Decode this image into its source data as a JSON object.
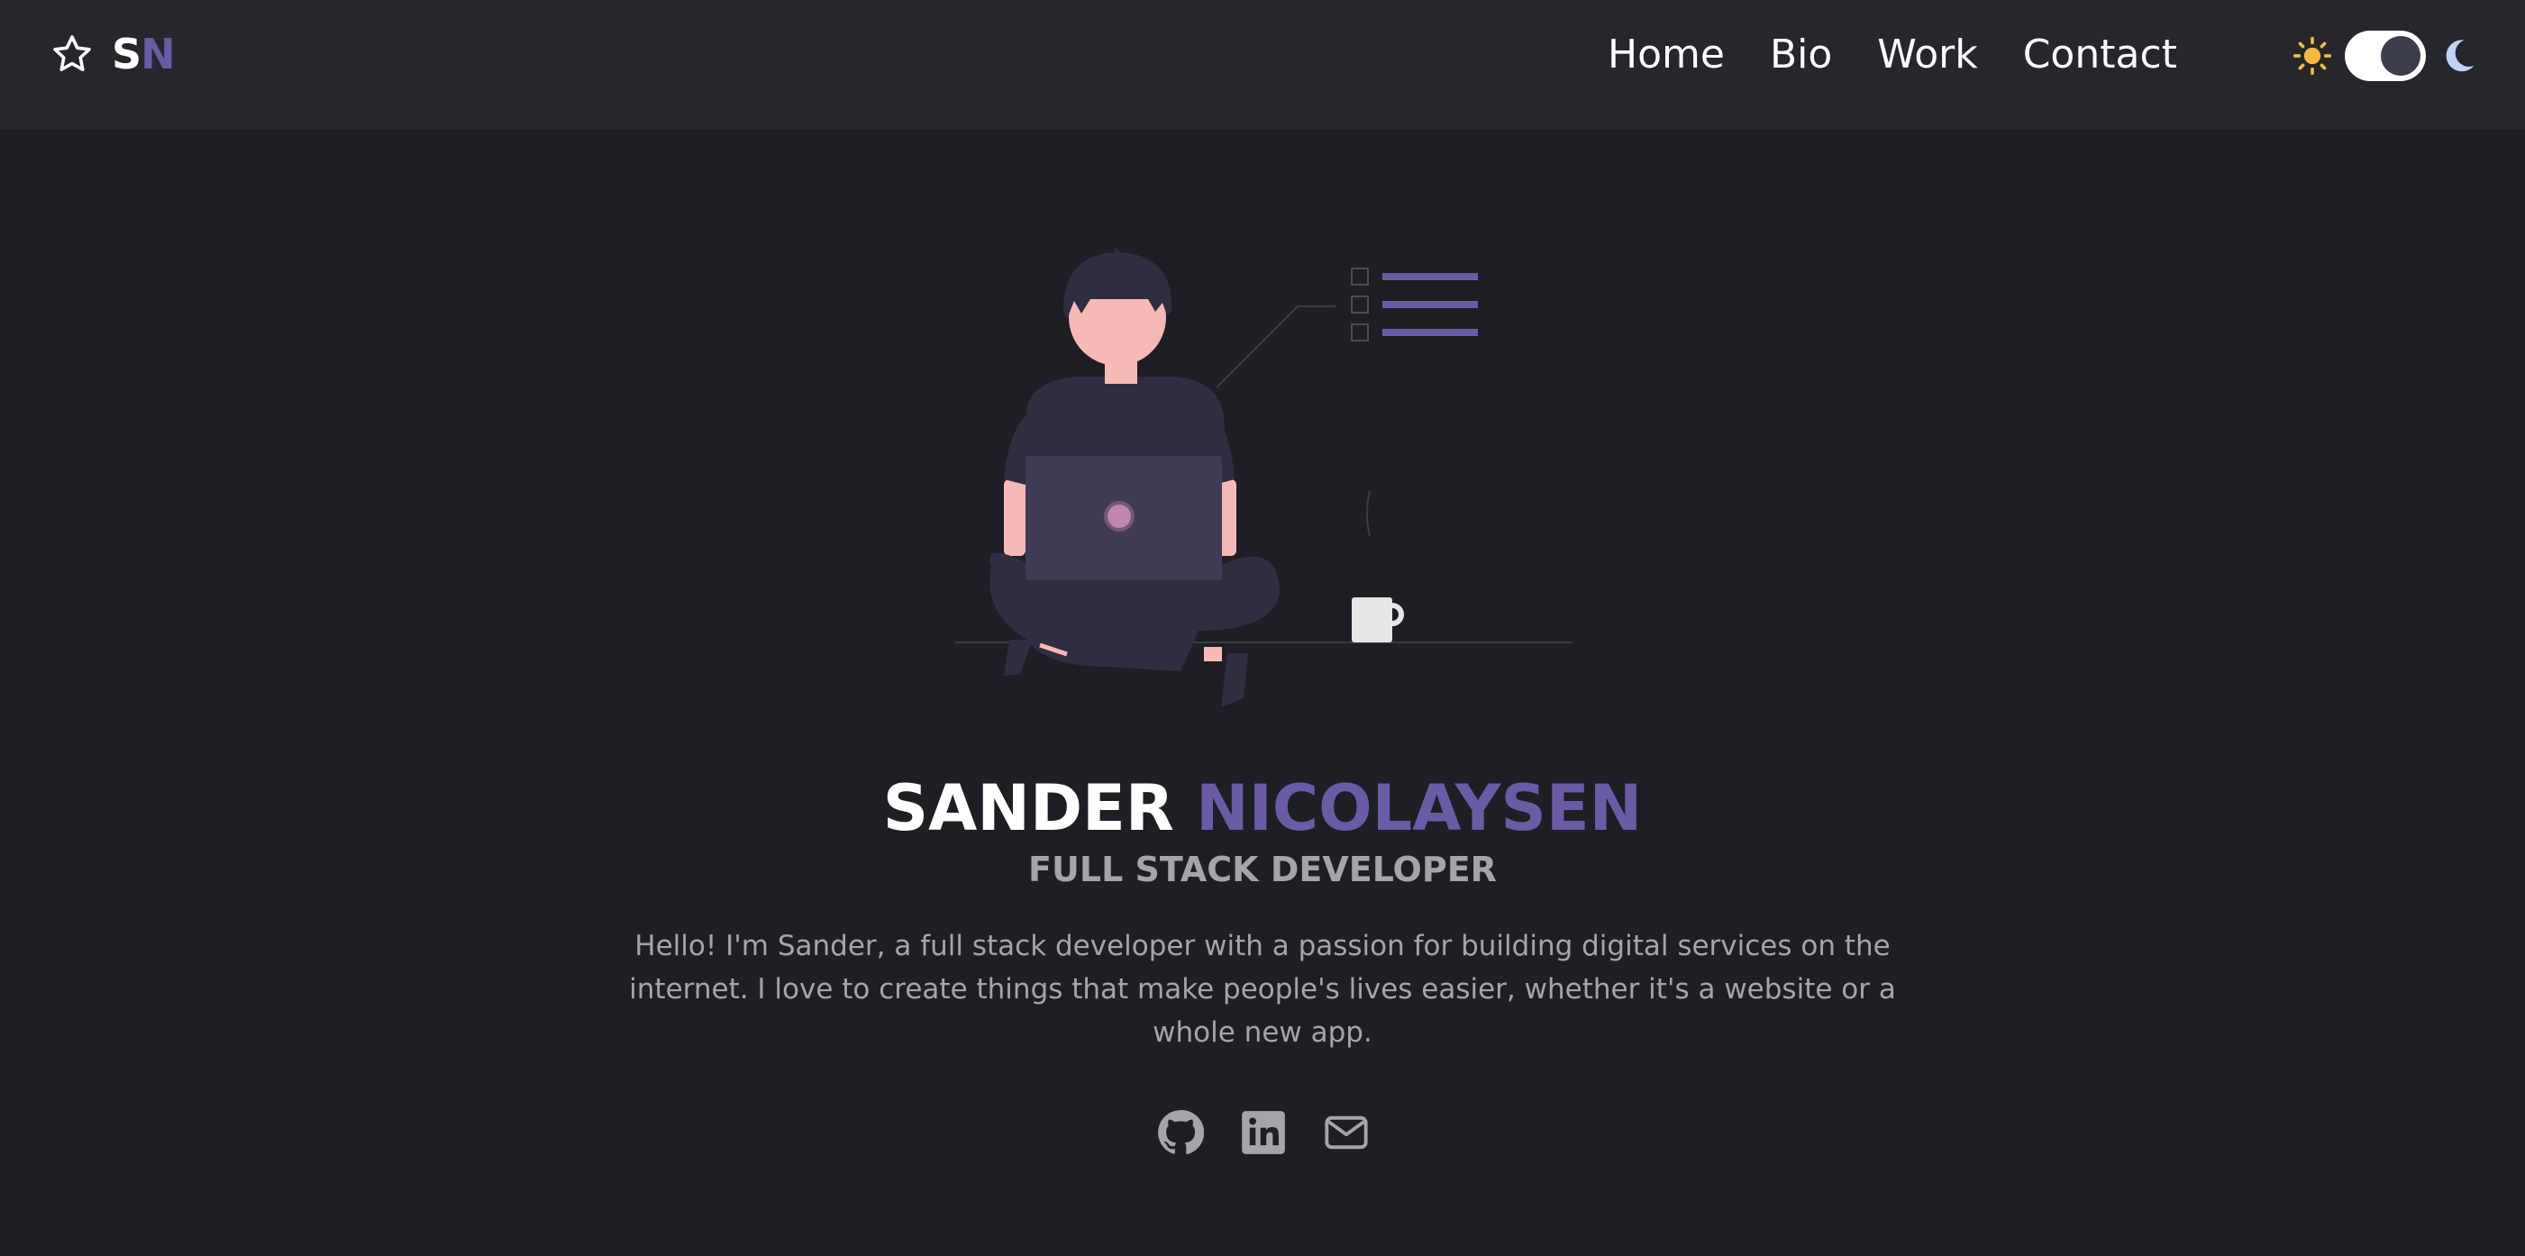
{
  "header": {
    "brand": {
      "first": "S",
      "second": "N",
      "icon": "star-icon"
    },
    "nav": [
      {
        "label": "Home"
      },
      {
        "label": "Bio"
      },
      {
        "label": "Work"
      },
      {
        "label": "Contact"
      }
    ],
    "theme_toggle": {
      "mode": "dark",
      "left_icon": "sun-icon",
      "right_icon": "moon-icon"
    }
  },
  "hero": {
    "first_name": "SANDER",
    "last_name": "NICOLAYSEN",
    "role": "FULL STACK DEVELOPER",
    "bio": "Hello! I'm Sander, a full stack developer with a passion for building digital services on the internet. I love to create things that make people's lives easier, whether it's a website or a whole new app."
  },
  "social": [
    {
      "name": "github-icon"
    },
    {
      "name": "linkedin-icon"
    },
    {
      "name": "mail-icon"
    }
  ],
  "colors": {
    "background": "#1d1f24",
    "navbar": "#25272c",
    "accent": "#6b5ba6",
    "text": "#ffffff",
    "muted": "#a3a5ab"
  }
}
